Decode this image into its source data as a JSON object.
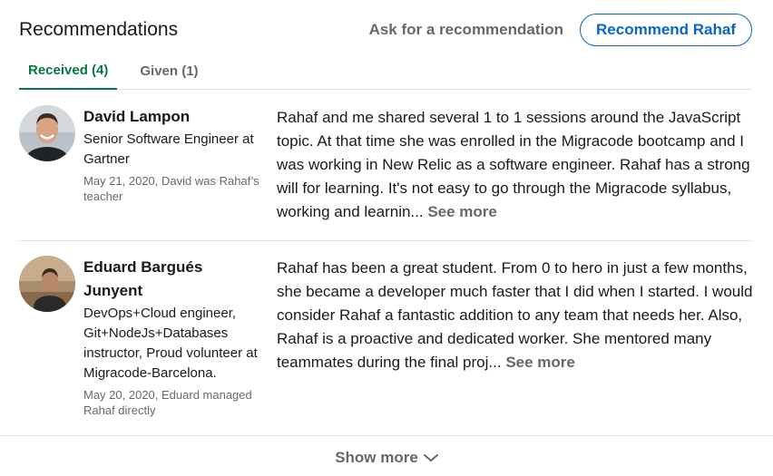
{
  "section": {
    "title": "Recommendations",
    "ask_label": "Ask for a recommendation",
    "recommend_label": "Recommend Rahaf"
  },
  "tabs": [
    {
      "label": "Received (4)",
      "active": true
    },
    {
      "label": "Given (1)",
      "active": false
    }
  ],
  "recommendations": [
    {
      "name": "David Lampon",
      "headline": "Senior Software Engineer at Gartner",
      "meta": "May 21, 2020, David was Rahaf’s teacher",
      "text": "Rahaf and me shared several 1 to 1 sessions around the JavaScript topic. At that time she was enrolled in the Migracode bootcamp and I was working in New Relic as a software engineer. Rahaf has a strong will for learning. It's not easy to go through the Migracode syllabus, working and learnin...",
      "see_more": "See more"
    },
    {
      "name": "Eduard Bargués Junyent",
      "headline": "DevOps+Cloud engineer, Git+NodeJs+Databases instructor, Proud volunteer at Migracode-Barcelona.",
      "meta": "May 20, 2020, Eduard managed Rahaf directly",
      "text": "Rahaf has been a great student. From 0 to hero in just a few months, she became a developer much faster that I did when I started. I would consider Rahaf a fantastic addition to any team that needs her. Also, Rahaf is a proactive and dedicated worker. She mentored many teammates during the final proj...",
      "see_more": "See more"
    }
  ],
  "footer": {
    "show_more_label": "Show more",
    "icon": "chevron-down-icon"
  },
  "colors": {
    "accent_blue": "#0a66c2",
    "active_tab_green": "#057642",
    "divider": "#e0dfdc"
  }
}
